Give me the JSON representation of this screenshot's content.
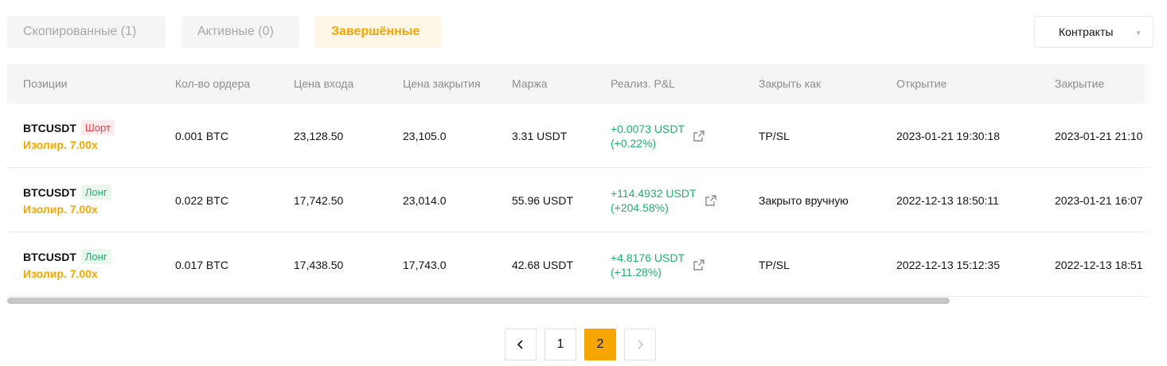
{
  "tabs": [
    {
      "label": "Скопированные (1)",
      "state": "inactive"
    },
    {
      "label": "Активные (0)",
      "state": "inactive"
    },
    {
      "label": "Завершённые",
      "state": "active"
    }
  ],
  "filter": {
    "selected": "Контракты"
  },
  "columns": [
    "Позиции",
    "Кол-во ордера",
    "Цена входа",
    "Цена закрытия",
    "Маржа",
    "Реализ. P&L",
    "Закрыть как",
    "Открытие",
    "Закрытие"
  ],
  "rows": [
    {
      "symbol": "BTCUSDT",
      "side": "Шорт",
      "side_type": "short",
      "leverage": "Изолир. 7.00x",
      "qty": "0.001 BTC",
      "entry": "23,128.50",
      "close": "23,105.0",
      "margin": "3.31 USDT",
      "pnl": "+0.0073 USDT",
      "pnl_pct": "(+0.22%)",
      "close_type": "TP/SL",
      "opened": "2023-01-21 19:30:18",
      "closed": "2023-01-21 21:10"
    },
    {
      "symbol": "BTCUSDT",
      "side": "Лонг",
      "side_type": "long",
      "leverage": "Изолир. 7.00x",
      "qty": "0.022 BTC",
      "entry": "17,742.50",
      "close": "23,014.0",
      "margin": "55.96 USDT",
      "pnl": "+114.4932 USDT",
      "pnl_pct": "(+204.58%)",
      "close_type": "Закрыто вручную",
      "opened": "2022-12-13 18:50:11",
      "closed": "2023-01-21 16:07"
    },
    {
      "symbol": "BTCUSDT",
      "side": "Лонг",
      "side_type": "long",
      "leverage": "Изолир. 7.00x",
      "qty": "0.017 BTC",
      "entry": "17,438.50",
      "close": "17,743.0",
      "margin": "42.68 USDT",
      "pnl": "+4.8176 USDT",
      "pnl_pct": "(+11.28%)",
      "close_type": "TP/SL",
      "opened": "2022-12-13 15:12:35",
      "closed": "2022-12-13 18:51"
    }
  ],
  "pagination": {
    "prev": "‹",
    "pages": [
      "1",
      "2"
    ],
    "current": "2",
    "next": "›"
  },
  "colors": {
    "accent": "#f7a600",
    "profit": "#20b26c",
    "loss": "#e03f4b"
  }
}
